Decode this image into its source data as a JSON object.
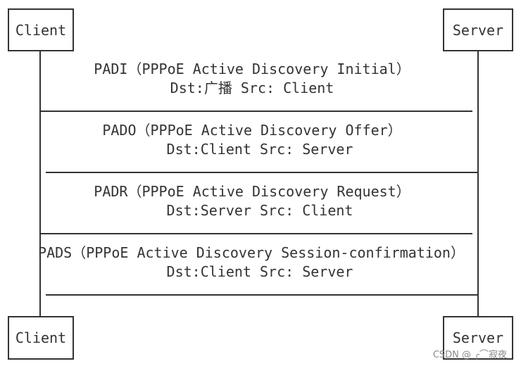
{
  "participants": {
    "client_top": "Client",
    "server_top": "Server",
    "client_bottom": "Client",
    "server_bottom": "Server"
  },
  "messages": [
    {
      "title": "PADI（PPPoE Active Discovery Initial）",
      "addr": "Dst:广播 Src: Client"
    },
    {
      "title": "PADO（PPPoE Active Discovery Offer）",
      "addr": "Dst:Client Src: Server"
    },
    {
      "title": "PADR（PPPoE Active Discovery Request）",
      "addr": "Dst:Server Src: Client"
    },
    {
      "title": "PADS（PPPoE Active Discovery Session-confirmation）",
      "addr": "Dst:Client Src: Server"
    }
  ],
  "watermark": "CSDN @ ╭⌒寂夜"
}
